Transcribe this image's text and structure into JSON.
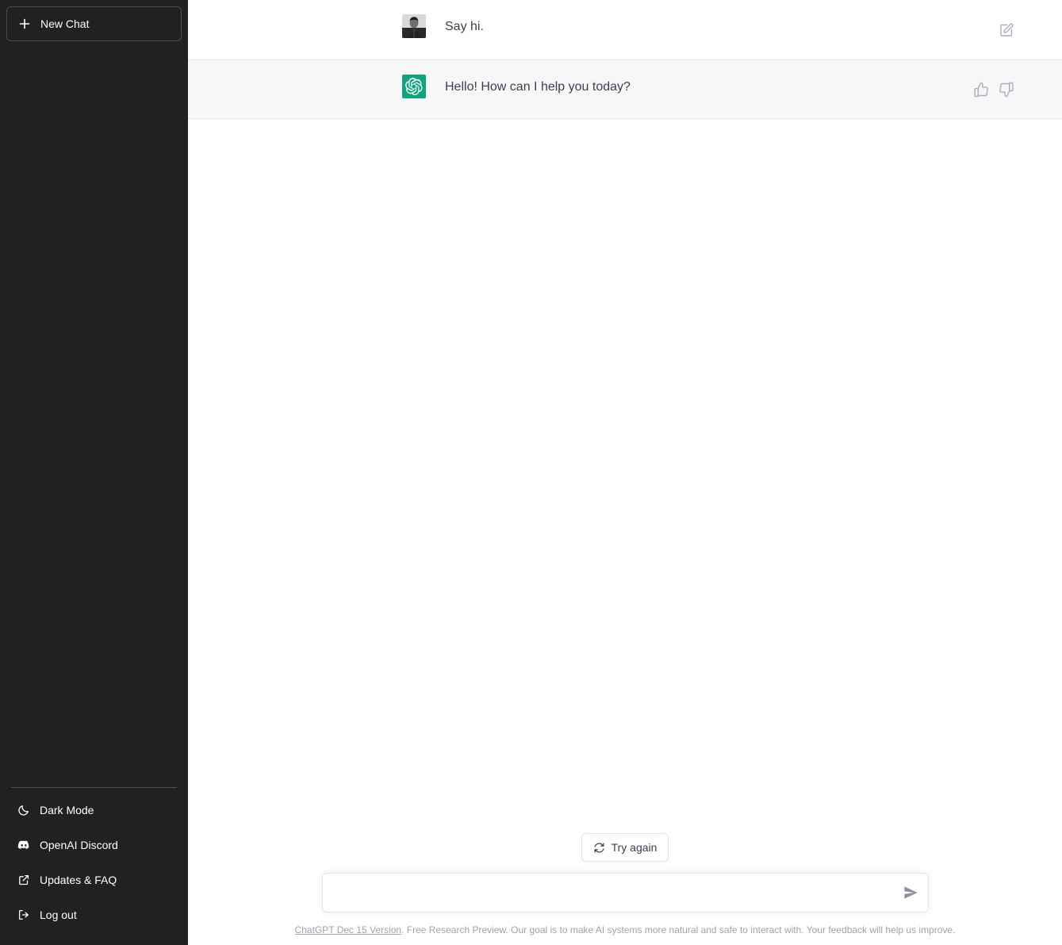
{
  "sidebar": {
    "new_chat_label": "New Chat",
    "footer_items": [
      {
        "label": "Dark Mode",
        "icon": "moon-icon"
      },
      {
        "label": "OpenAI Discord",
        "icon": "discord-icon"
      },
      {
        "label": "Updates & FAQ",
        "icon": "external-link-icon"
      },
      {
        "label": "Log out",
        "icon": "logout-icon"
      }
    ]
  },
  "conversation": {
    "messages": [
      {
        "role": "user",
        "text": "Say hi.",
        "avatar": "user-photo-avatar"
      },
      {
        "role": "assistant",
        "text": "Hello! How can I help you today?",
        "avatar": "openai-logo-avatar"
      }
    ]
  },
  "actions": {
    "edit_icon": "edit-icon",
    "thumbs_up_icon": "thumbs-up-icon",
    "thumbs_down_icon": "thumbs-down-icon",
    "try_again_label": "Try again",
    "try_again_icon": "refresh-icon",
    "send_icon": "send-icon"
  },
  "composer": {
    "placeholder": "",
    "value": ""
  },
  "footer": {
    "version_link": "ChatGPT Dec 15 Version",
    "disclaimer": ". Free Research Preview. Our goal is to make AI systems more natural and safe to interact with. Your feedback will help us improve."
  },
  "colors": {
    "sidebar_bg": "#202123",
    "assistant_row_bg": "#f7f7f8",
    "accent_green": "#10a37f",
    "text_primary": "#374151",
    "muted": "#9ca3af"
  }
}
